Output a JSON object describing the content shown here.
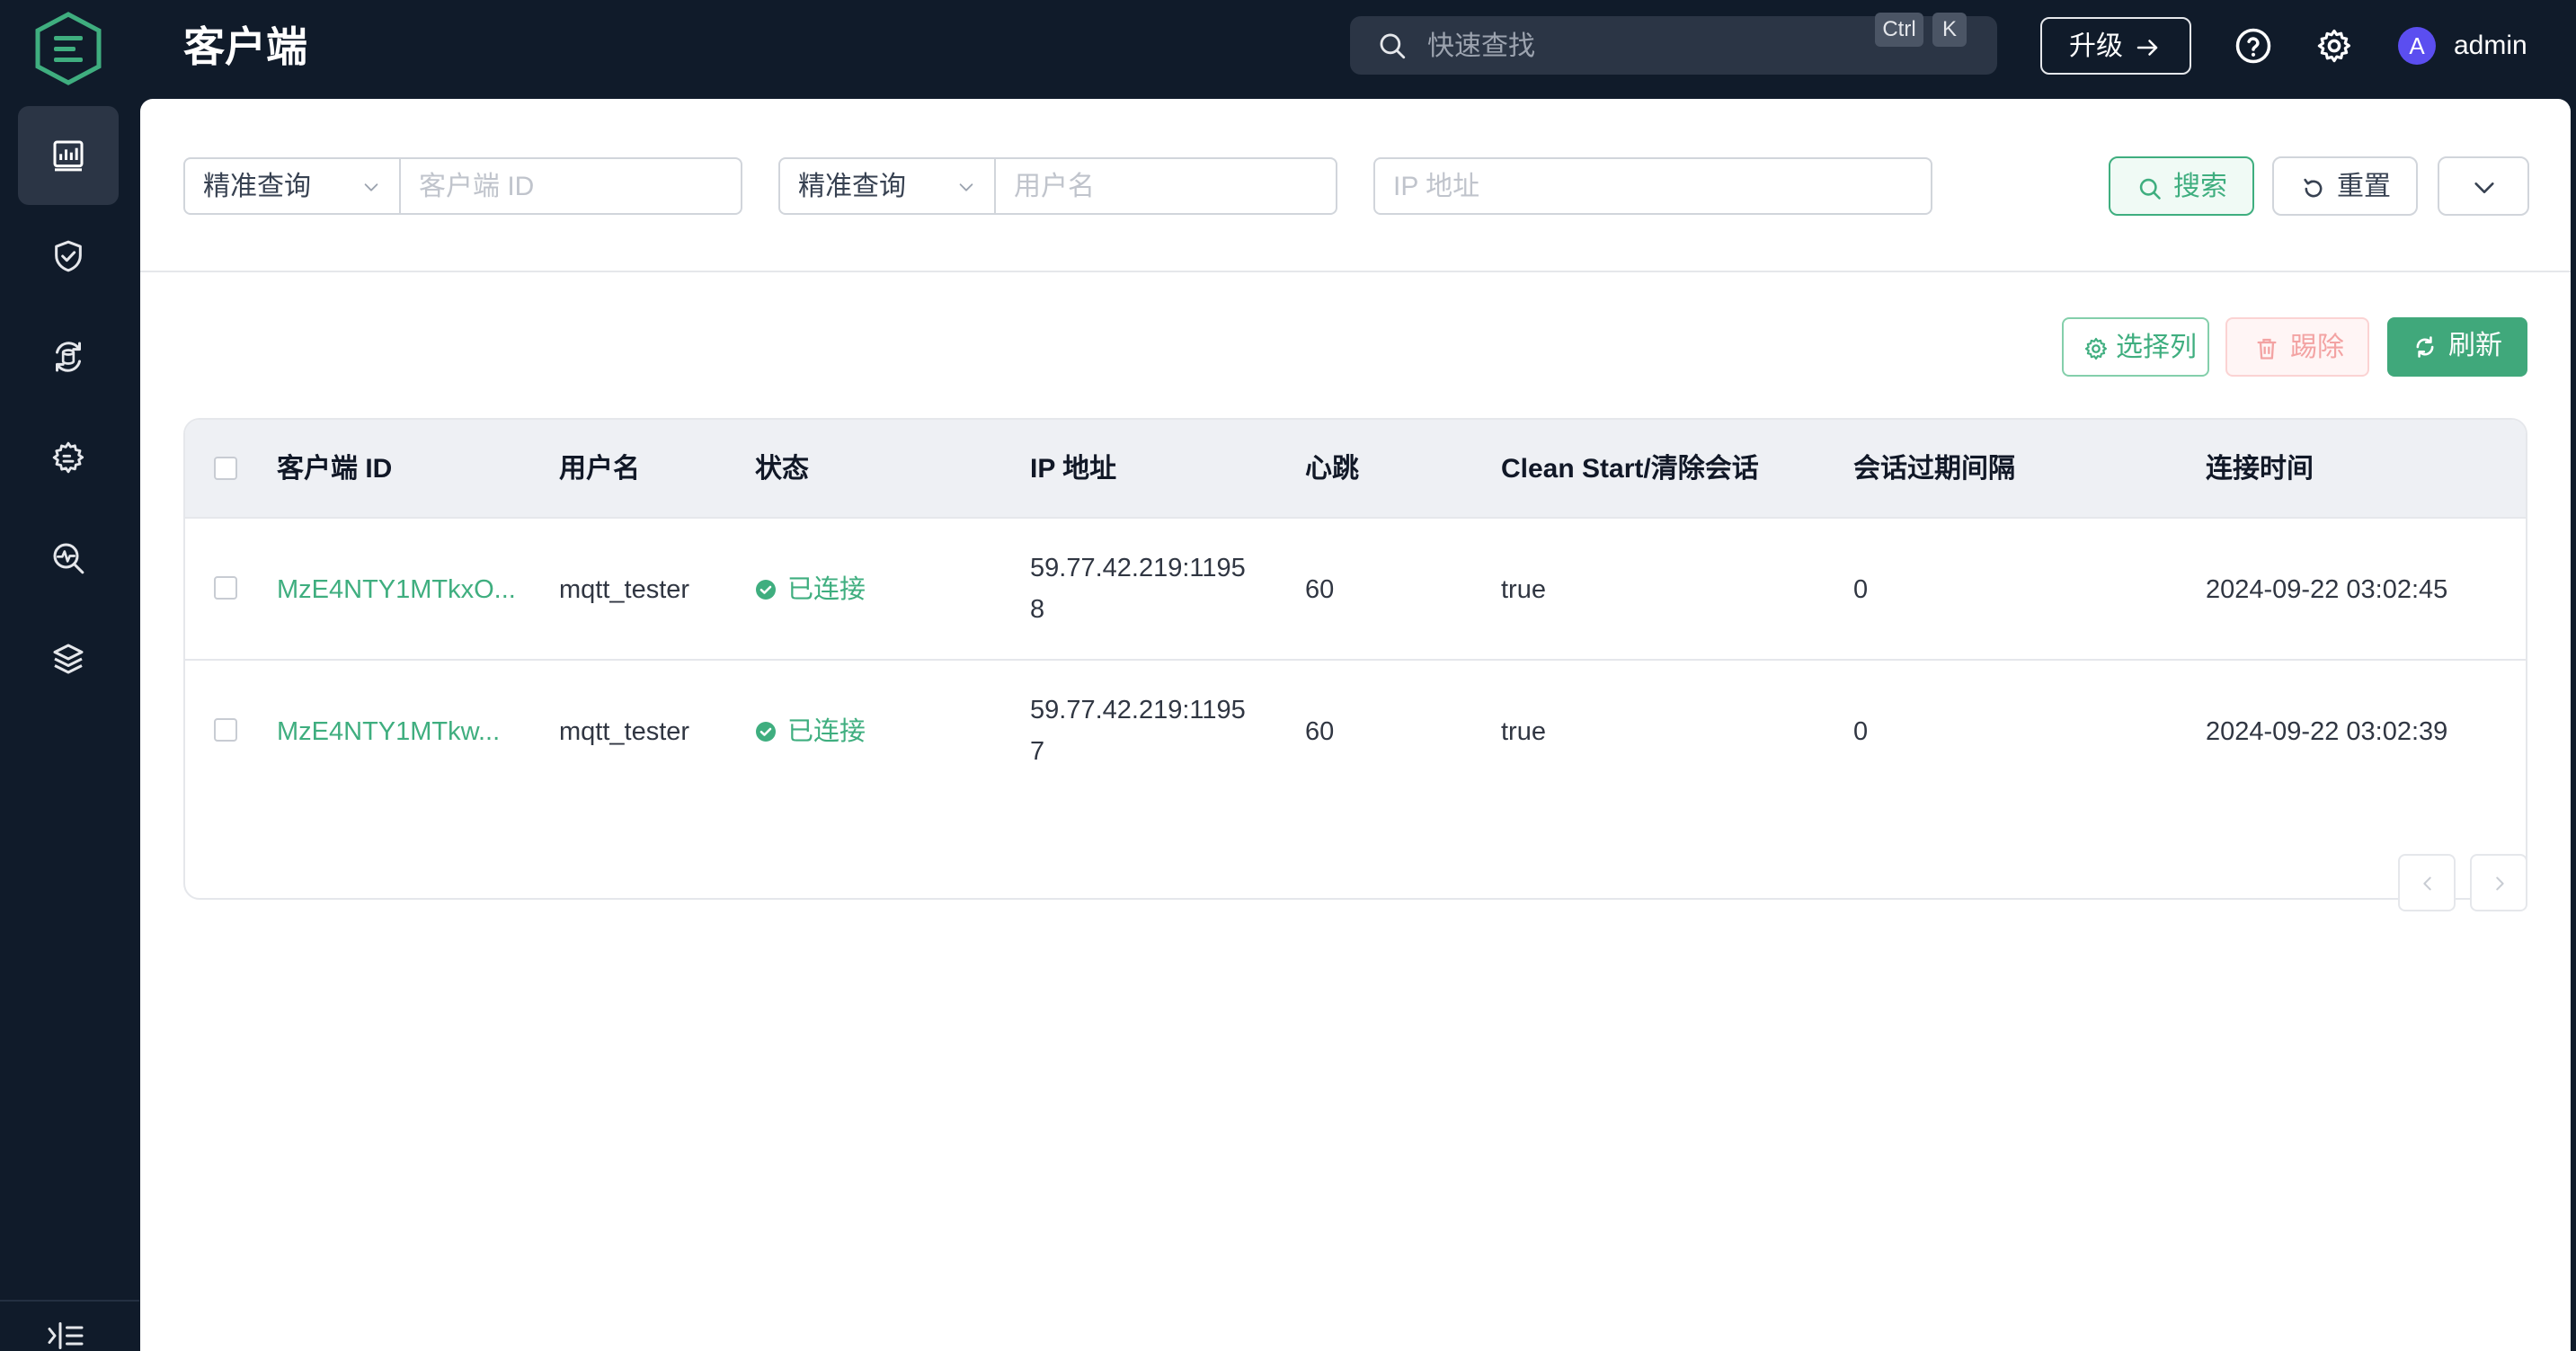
{
  "header": {
    "title": "客户端",
    "search_placeholder": "快速查找",
    "shortcut_keys": [
      "Ctrl",
      "K"
    ],
    "upgrade_label": "升级",
    "avatar_letter": "A",
    "username": "admin"
  },
  "sidebar": {
    "items": [
      {
        "icon": "dashboard-icon",
        "active": true
      },
      {
        "icon": "shield-check-icon",
        "active": false
      },
      {
        "icon": "data-integration-icon",
        "active": false
      },
      {
        "icon": "management-gear-icon",
        "active": false
      },
      {
        "icon": "diagnose-icon",
        "active": false
      },
      {
        "icon": "layers-icon",
        "active": false
      }
    ],
    "collapse_icon": "sidebar-expand-icon"
  },
  "filters": {
    "clientid_mode": "精准查询",
    "clientid_placeholder": "客户端 ID",
    "username_mode": "精准查询",
    "username_placeholder": "用户名",
    "ip_placeholder": "IP 地址",
    "search_label": "搜索",
    "reset_label": "重置"
  },
  "toolbar": {
    "columns_label": "选择列",
    "kick_label": "踢除",
    "refresh_label": "刷新"
  },
  "table": {
    "columns": [
      "客户端 ID",
      "用户名",
      "状态",
      "IP 地址",
      "心跳",
      "Clean Start/清除会话",
      "会话过期间隔",
      "连接时间"
    ],
    "rows": [
      {
        "client_id": "MzE4NTY1MTkxO...",
        "username": "mqtt_tester",
        "status": "已连接",
        "ip": "59.77.42.219:11958",
        "keepalive": "60",
        "clean_start": "true",
        "expiry": "0",
        "connected_at": "2024-09-22 03:02:45"
      },
      {
        "client_id": "MzE4NTY1MTkw...",
        "username": "mqtt_tester",
        "status": "已连接",
        "ip": "59.77.42.219:11957",
        "keepalive": "60",
        "clean_start": "true",
        "expiry": "0",
        "connected_at": "2024-09-22 03:02:39"
      }
    ]
  },
  "colors": {
    "brand_green": "#3fae7f",
    "navbar_bg": "#101b2a",
    "avatar_bg": "#5b4ef0"
  }
}
